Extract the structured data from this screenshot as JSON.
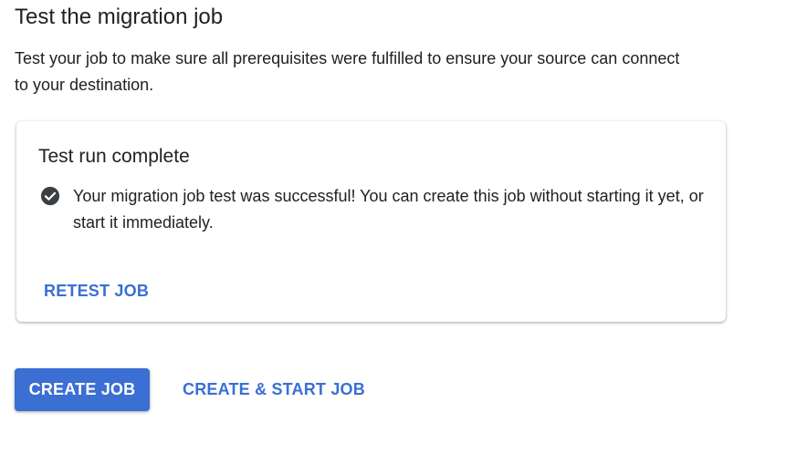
{
  "section": {
    "title": "Test the migration job",
    "description": "Test your job to make sure all prerequisites were fulfilled to ensure your source can connect to your destination."
  },
  "test_card": {
    "title": "Test run complete",
    "status_icon": "check-circle-icon",
    "status_message": "Your migration job test was successful! You can create this job without starting it yet, or start it immediately.",
    "retest_label": "RETEST JOB"
  },
  "actions": {
    "create_label": "CREATE JOB",
    "create_start_label": "CREATE & START JOB"
  },
  "colors": {
    "accent": "#3b6fd4",
    "success_icon": "#3c4043",
    "text": "#202124"
  }
}
